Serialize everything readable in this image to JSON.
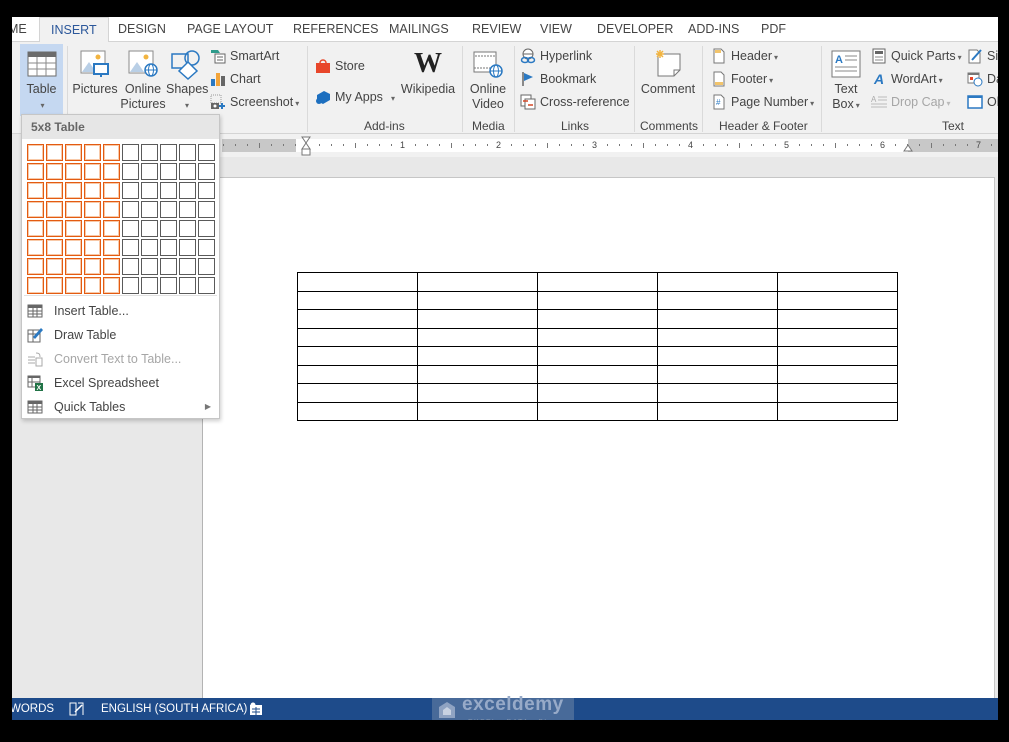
{
  "tabs": [
    {
      "label": "ME",
      "active": false
    },
    {
      "label": "INSERT",
      "active": true
    },
    {
      "label": "DESIGN",
      "active": false
    },
    {
      "label": "PAGE LAYOUT",
      "active": false
    },
    {
      "label": "REFERENCES",
      "active": false
    },
    {
      "label": "MAILINGS",
      "active": false
    },
    {
      "label": "REVIEW",
      "active": false
    },
    {
      "label": "VIEW",
      "active": false
    },
    {
      "label": "DEVELOPER",
      "active": false
    },
    {
      "label": "ADD-INS",
      "active": false
    },
    {
      "label": "PDF",
      "active": false
    }
  ],
  "ribbon": {
    "tables": {
      "table_label": "Table",
      "icon": "table-icon"
    },
    "illustrations": {
      "pictures": "Pictures",
      "online_pictures_1": "Online",
      "online_pictures_2": "Pictures",
      "shapes": "Shapes",
      "smartart": "SmartArt",
      "chart": "Chart",
      "screenshot": "Screenshot"
    },
    "addins": {
      "store": "Store",
      "my_apps": "My Apps",
      "wikipedia": "Wikipedia",
      "wikipedia_glyph": "W",
      "label": "Add-ins"
    },
    "media": {
      "online_video_1": "Online",
      "online_video_2": "Video",
      "label": "Media"
    },
    "links": {
      "hyperlink": "Hyperlink",
      "bookmark": "Bookmark",
      "cross_reference": "Cross-reference",
      "label": "Links"
    },
    "comments": {
      "comment": "Comment",
      "label": "Comments"
    },
    "header_footer": {
      "header": "Header",
      "footer": "Footer",
      "page_number": "Page Number",
      "label": "Header & Footer"
    },
    "text": {
      "text_box_1": "Text",
      "text_box_2": "Box",
      "quick_parts": "Quick Parts",
      "wordart": "WordArt",
      "drop_cap": "Drop Cap",
      "sig": "Si",
      "date": "Da",
      "object": "Ol",
      "label": "Text"
    }
  },
  "ruler": {
    "numbers": [
      "1",
      "2",
      "3",
      "4",
      "5",
      "6",
      "7"
    ]
  },
  "table_menu": {
    "header": "5x8 Table",
    "grid_cols": 10,
    "grid_rows": 8,
    "selected_cols": 5,
    "selected_rows": 8,
    "selected_color": "#e35b12",
    "items": [
      {
        "label": "Insert Table...",
        "icon": "insert-table-icon",
        "disabled": false
      },
      {
        "label": "Draw Table",
        "icon": "draw-table-icon",
        "disabled": false
      },
      {
        "label": "Convert Text to Table...",
        "icon": "convert-text-icon",
        "disabled": true
      },
      {
        "label": "Excel Spreadsheet",
        "icon": "excel-spreadsheet-icon",
        "disabled": false
      },
      {
        "label": "Quick Tables",
        "icon": "quick-tables-icon",
        "disabled": false,
        "submenu": true
      }
    ]
  },
  "document": {
    "table": {
      "columns": 5,
      "rows": 8
    }
  },
  "status_bar": {
    "words": "WORDS",
    "language": "ENGLISH (SOUTH AFRICA)",
    "color": "#1e4b8a"
  },
  "watermark": {
    "title": "exceldemy",
    "subtitle": "EXCEL · DATA · BI"
  }
}
